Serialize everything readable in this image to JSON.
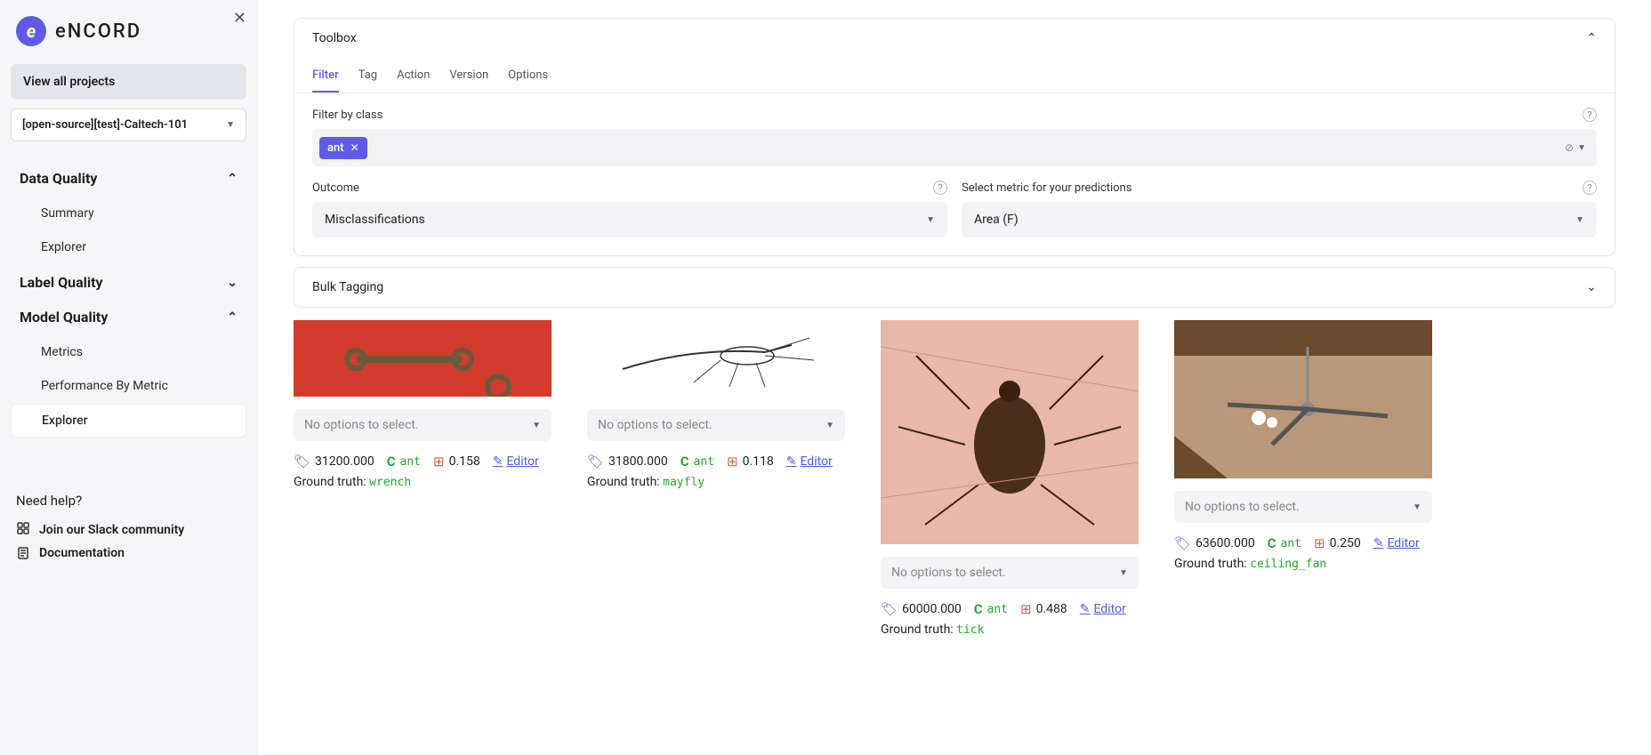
{
  "brand": "eNCORD",
  "sidebar": {
    "view_all": "View all projects",
    "project_name": "[open-source][test]-Caltech-101",
    "groups": [
      {
        "label": "Data Quality",
        "expanded": true,
        "items": [
          "Summary",
          "Explorer"
        ]
      },
      {
        "label": "Label Quality",
        "expanded": false,
        "items": []
      },
      {
        "label": "Model Quality",
        "expanded": true,
        "items": [
          "Metrics",
          "Performance By Metric",
          "Explorer"
        ],
        "active_index": 2
      }
    ],
    "help_title": "Need help?",
    "help_links": [
      "Join our Slack community",
      "Documentation"
    ]
  },
  "toolbox": {
    "title": "Toolbox",
    "tabs": [
      "Filter",
      "Tag",
      "Action",
      "Version",
      "Options"
    ],
    "active_tab": 0,
    "filter_label": "Filter by class",
    "filter_chip": "ant",
    "outcome_label": "Outcome",
    "outcome_value": "Misclassifications",
    "metric_label": "Select metric for your predictions",
    "metric_value": "Area (F)"
  },
  "bulk_tagging": "Bulk Tagging",
  "no_options": "No options to select.",
  "editor_label": "Editor",
  "gt_prefix": "Ground truth:",
  "cards": [
    {
      "area": "31200.000",
      "cls": "ant",
      "score": "0.158",
      "gt": "wrench",
      "thumb_h": 86
    },
    {
      "area": "31800.000",
      "cls": "ant",
      "score": "0.118",
      "gt": "mayfly",
      "thumb_h": 86
    },
    {
      "area": "60000.000",
      "cls": "ant",
      "score": "0.488",
      "gt": "tick",
      "thumb_h": 252
    },
    {
      "area": "63600.000",
      "cls": "ant",
      "score": "0.250",
      "gt": "ceiling_fan",
      "thumb_h": 178
    }
  ]
}
